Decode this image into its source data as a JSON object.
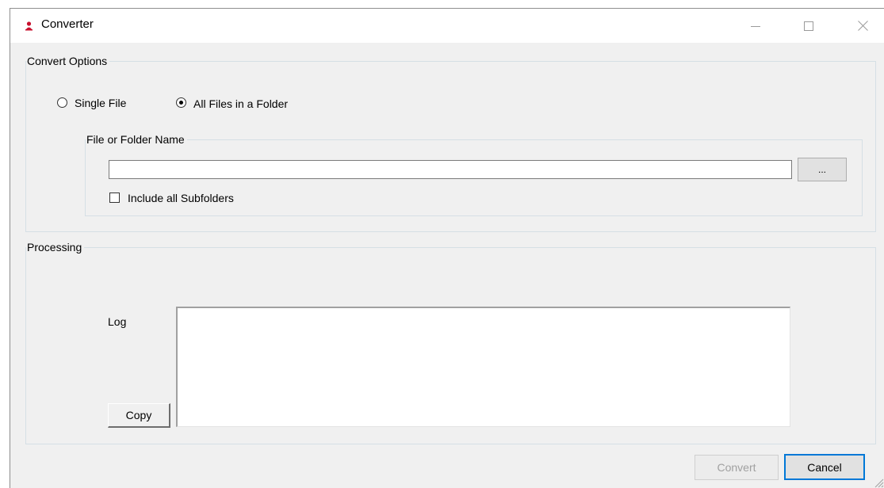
{
  "window": {
    "title": "Converter",
    "icon": "app-icon",
    "controls": [
      "minimize-icon",
      "maximize-icon",
      "close-icon"
    ]
  },
  "convert_options": {
    "group_label": "Convert Options",
    "radio_single": "Single File",
    "radio_folder": "All Files in a Folder",
    "selected": "All Files in a Folder"
  },
  "file_folder": {
    "group_label": "File or Folder Name",
    "path_value": "",
    "browse_label": "...",
    "include_subfolders_label": "Include all Subfolders",
    "include_subfolders_checked": false
  },
  "processing": {
    "group_label": "Processing",
    "log_label": "Log",
    "log_text": "",
    "copy_label": "Copy"
  },
  "footer": {
    "convert_label": "Convert",
    "convert_enabled": false,
    "cancel_label": "Cancel"
  },
  "colors": {
    "accent": "#0078d7",
    "window_bg": "#f0f0f0",
    "app_icon": "#c8102e"
  }
}
